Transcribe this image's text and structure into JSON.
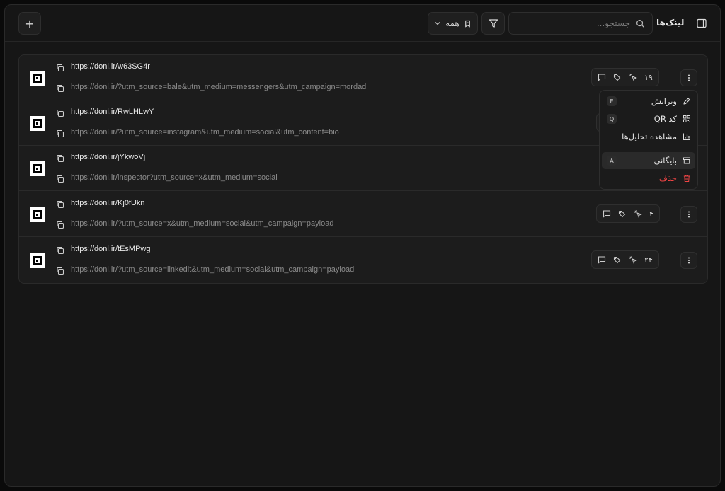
{
  "header": {
    "title": "لینک‌ها",
    "search_placeholder": "جستجو...",
    "filter_all_label": "همه",
    "add_label": "+"
  },
  "links": [
    {
      "short": "https://donl.ir/w63SG4r",
      "long": "https://donl.ir/?utm_source=bale&utm_medium=messengers&utm_campaign=mordad",
      "clicks": "۱۹",
      "stats_visible": true
    },
    {
      "short": "https://donl.ir/RwLHLwY",
      "long": "https://donl.ir/?utm_source=instagram&utm_medium=social&utm_content=bio",
      "clicks": "",
      "stats_visible": false
    },
    {
      "short": "https://donl.ir/jYkwoVj",
      "long": "https://donl.ir/inspector?utm_source=x&utm_medium=social",
      "clicks": "",
      "stats_visible": false
    },
    {
      "short": "https://donl.ir/Kj0fUkn",
      "long": "https://donl.ir/?utm_source=x&utm_medium=social&utm_campaign=payload",
      "clicks": "۴",
      "stats_visible": true
    },
    {
      "short": "https://donl.ir/tEsMPwg",
      "long": "https://donl.ir/?utm_source=linkedit&utm_medium=social&utm_campaign=payload",
      "clicks": "۲۴",
      "stats_visible": true
    }
  ],
  "context_menu": {
    "edit": {
      "label": "ویرایش",
      "shortcut": "E"
    },
    "qr": {
      "label": "کد QR",
      "shortcut": "Q"
    },
    "analytics": {
      "label": "مشاهده تحلیل‌ها"
    },
    "archive": {
      "label": "بایگانی",
      "shortcut": "A"
    },
    "delete": {
      "label": "حذف"
    }
  },
  "colors": {
    "danger": "#ef4444",
    "background": "#161616"
  }
}
